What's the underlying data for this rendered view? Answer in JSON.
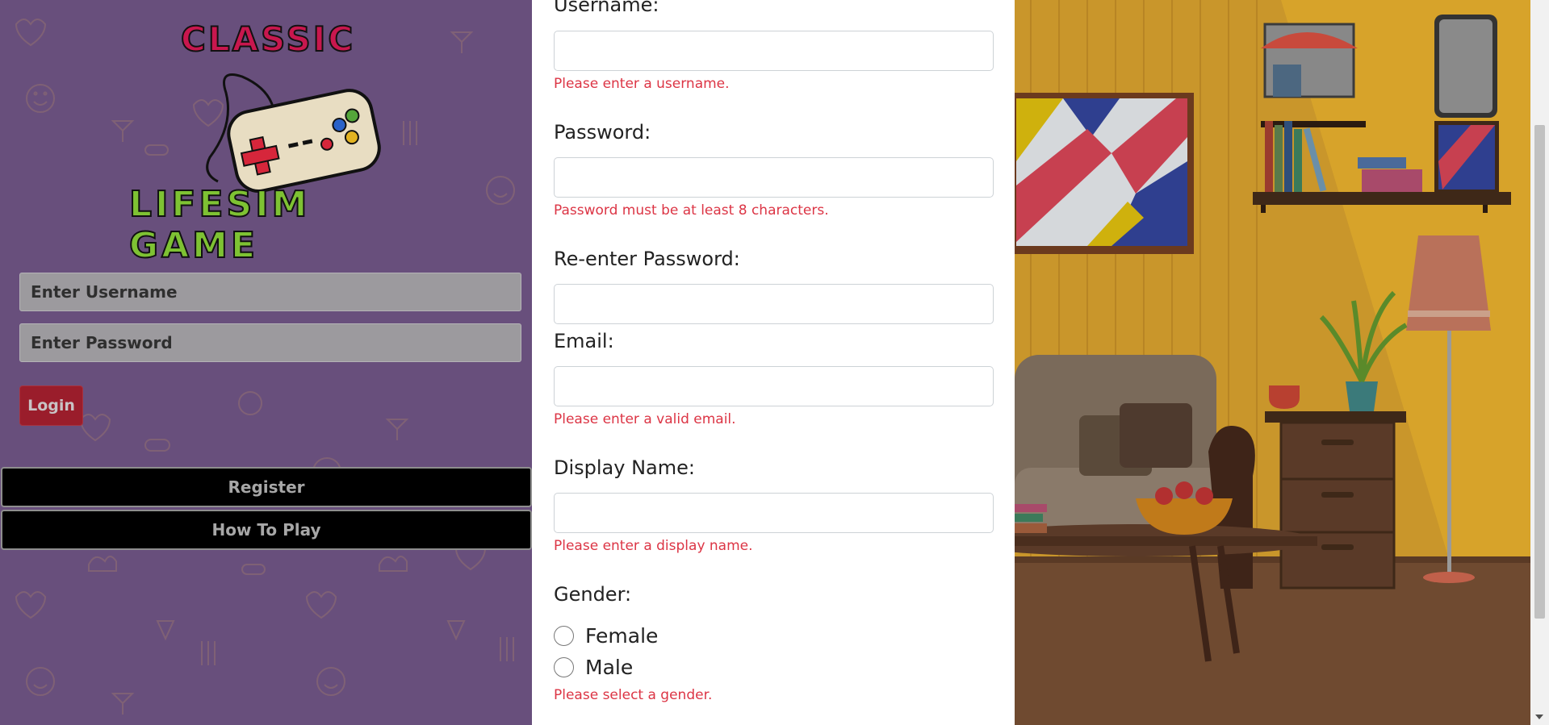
{
  "left_panel": {
    "logo": {
      "title_top": "CLASSIC",
      "title_bottom": "LIFESIM GAME"
    },
    "username_placeholder": "Enter Username",
    "password_placeholder": "Enter Password",
    "login_label": "Login",
    "register_label": "Register",
    "how_to_play_label": "How To Play"
  },
  "register_form": {
    "username": {
      "label": "Username:",
      "value": "",
      "error": "Please enter a username."
    },
    "password": {
      "label": "Password:",
      "value": "",
      "error": "Password must be at least 8 characters."
    },
    "reenter_password": {
      "label": "Re-enter Password:",
      "value": ""
    },
    "email": {
      "label": "Email:",
      "value": "",
      "error": "Please enter a valid email."
    },
    "display_name": {
      "label": "Display Name:",
      "value": "",
      "error": "Please enter a display name."
    },
    "gender": {
      "label": "Gender:",
      "options": [
        "Female",
        "Male"
      ],
      "error": "Please select a gender."
    }
  },
  "colors": {
    "left_bg": "#684f7c",
    "login_button": "#9a1d2b",
    "error_text": "#dc3545",
    "room_wall": "#d7a32a",
    "room_floor": "#6f4a30"
  }
}
